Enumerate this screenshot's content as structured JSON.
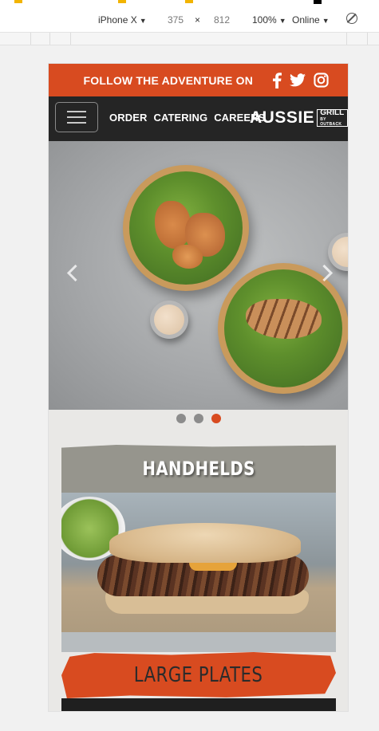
{
  "devtools": {
    "device": "iPhone X",
    "width": "375",
    "times": "×",
    "height": "812",
    "zoom": "100%",
    "network": "Online",
    "dropdown_arrow": "▼"
  },
  "site": {
    "follow_text": "FOLLOW THE ADVENTURE ON",
    "social": [
      {
        "name": "facebook-icon"
      },
      {
        "name": "twitter-icon"
      },
      {
        "name": "instagram-icon"
      }
    ],
    "nav": [
      "ORDER",
      "CATERING",
      "CAREERS"
    ],
    "logo": {
      "main": "AUSSIE",
      "grill": "GRILL",
      "sub": "BY OUTBACK"
    },
    "carousel": {
      "slides": 3,
      "active_index": 2
    },
    "categories": [
      {
        "title": "HANDHELDS"
      },
      {
        "title": "LARGE PLATES"
      }
    ]
  },
  "colors": {
    "brand_orange": "#d84b20",
    "nav_dark": "#252525",
    "card_gray": "#96958d"
  }
}
